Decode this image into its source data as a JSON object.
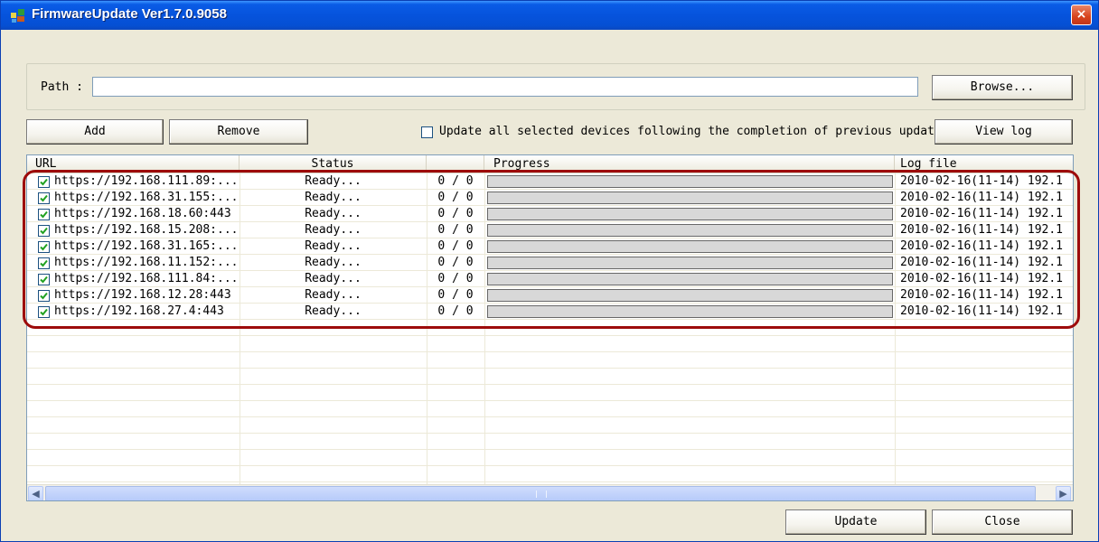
{
  "window": {
    "title": "FirmwareUpdate Ver1.7.0.9058",
    "close_glyph": "×",
    "app_icon": "firmware-update-app-icon"
  },
  "path": {
    "label": "Path :",
    "value": "",
    "browse_label": "Browse..."
  },
  "toolbar": {
    "add_label": "Add",
    "remove_label": "Remove",
    "sequential_update_checked": false,
    "sequential_update_label": "Update all selected devices following the completion of previous update.",
    "view_log_label": "View log"
  },
  "list": {
    "columns": [
      "URL",
      "Status",
      "",
      "Progress",
      "Log file"
    ],
    "rows": [
      {
        "checked": true,
        "url": "https://192.168.111.89:...",
        "status": "Ready...",
        "count": "0 / 0",
        "progress": 0,
        "log": "2010-02-16(11-14) 192.1"
      },
      {
        "checked": true,
        "url": "https://192.168.31.155:...",
        "status": "Ready...",
        "count": "0 / 0",
        "progress": 0,
        "log": "2010-02-16(11-14) 192.1"
      },
      {
        "checked": true,
        "url": "https://192.168.18.60:443",
        "status": "Ready...",
        "count": "0 / 0",
        "progress": 0,
        "log": "2010-02-16(11-14) 192.1"
      },
      {
        "checked": true,
        "url": "https://192.168.15.208:...",
        "status": "Ready...",
        "count": "0 / 0",
        "progress": 0,
        "log": "2010-02-16(11-14) 192.1"
      },
      {
        "checked": true,
        "url": "https://192.168.31.165:...",
        "status": "Ready...",
        "count": "0 / 0",
        "progress": 0,
        "log": "2010-02-16(11-14) 192.1"
      },
      {
        "checked": true,
        "url": "https://192.168.11.152:...",
        "status": "Ready...",
        "count": "0 / 0",
        "progress": 0,
        "log": "2010-02-16(11-14) 192.1"
      },
      {
        "checked": true,
        "url": "https://192.168.111.84:...",
        "status": "Ready...",
        "count": "0 / 0",
        "progress": 0,
        "log": "2010-02-16(11-14) 192.1"
      },
      {
        "checked": true,
        "url": "https://192.168.12.28:443",
        "status": "Ready...",
        "count": "0 / 0",
        "progress": 0,
        "log": "2010-02-16(11-14) 192.1"
      },
      {
        "checked": true,
        "url": "https://192.168.27.4:443",
        "status": "Ready...",
        "count": "0 / 0",
        "progress": 0,
        "log": "2010-02-16(11-14) 192.1"
      }
    ],
    "scroll_left_glyph": "◀",
    "scroll_right_glyph": "▶"
  },
  "footer": {
    "update_label": "Update",
    "close_label": "Close"
  },
  "colors": {
    "titlebar": "#0653dc",
    "window_bg": "#ece9d8",
    "annotation_outline": "#9d0b0b",
    "checkmark": "#21a121"
  }
}
